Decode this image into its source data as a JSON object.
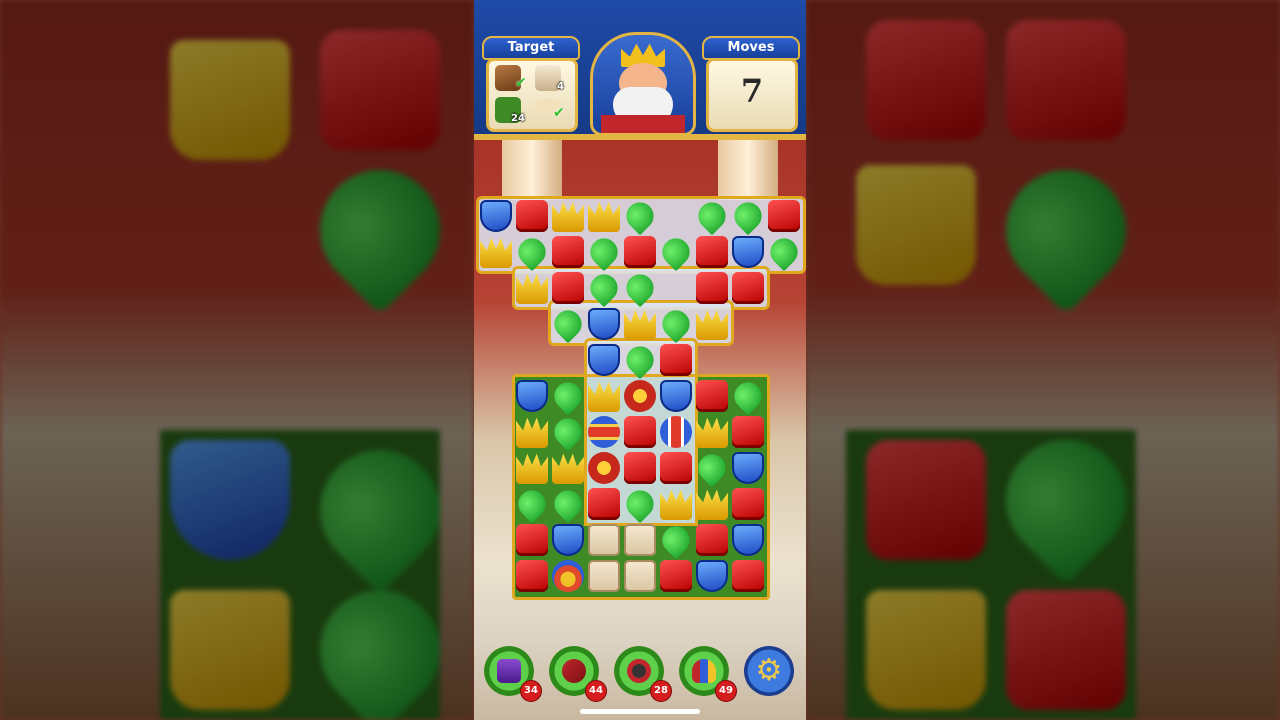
{
  "hud": {
    "target_label": "Target",
    "moves_label": "Moves",
    "moves_value": "7",
    "targets": [
      {
        "icon": "wooden-crate-icon",
        "count": "",
        "done": true
      },
      {
        "icon": "cat-statue-icon",
        "count": "4",
        "done": false
      },
      {
        "icon": "grass-tile-icon",
        "count": "24",
        "done": false
      },
      {
        "icon": "bone-icon",
        "count": "",
        "done": true
      }
    ]
  },
  "boosters": [
    {
      "name": "hammer-booster",
      "count": "34"
    },
    {
      "name": "arrow-booster",
      "count": "44"
    },
    {
      "name": "cannon-booster",
      "count": "28"
    },
    {
      "name": "jester-booster",
      "count": "49"
    }
  ],
  "colors": {
    "hud_blue": "#1b3e8f",
    "gold_border": "#e3b542",
    "badge_red": "#d61d1d"
  },
  "board": {
    "rows": [
      [
        "blue",
        "red",
        "yellow",
        "yellow",
        "green",
        "",
        "green",
        "green",
        "red"
      ],
      [
        "yellow",
        "green",
        "red",
        "green",
        "red",
        "green",
        "red",
        "blue",
        "green"
      ],
      [
        "",
        "yellow",
        "red",
        "green",
        "green",
        "",
        "red",
        "red",
        ""
      ],
      [
        "",
        "",
        "green",
        "blue",
        "yellow",
        "green",
        "yellow",
        "",
        ""
      ],
      [
        "",
        "",
        "",
        "blue",
        "green",
        "red",
        "",
        "",
        ""
      ],
      [
        "",
        "blue",
        "green",
        "yellow",
        "tnt",
        "blue",
        "red",
        "green",
        ""
      ],
      [
        "",
        "yellow",
        "green",
        "rocketv",
        "red",
        "rocket",
        "yellow",
        "red",
        ""
      ],
      [
        "",
        "yellow",
        "yellow",
        "tnt",
        "red",
        "red",
        "green",
        "blue",
        ""
      ],
      [
        "",
        "green",
        "green",
        "red",
        "green",
        "yellow",
        "yellow",
        "red",
        ""
      ],
      [
        "",
        "red",
        "blue",
        "box",
        "box",
        "green",
        "red",
        "blue",
        ""
      ],
      [
        "",
        "red",
        "jester",
        "box",
        "box",
        "red",
        "blue",
        "red",
        ""
      ]
    ]
  }
}
